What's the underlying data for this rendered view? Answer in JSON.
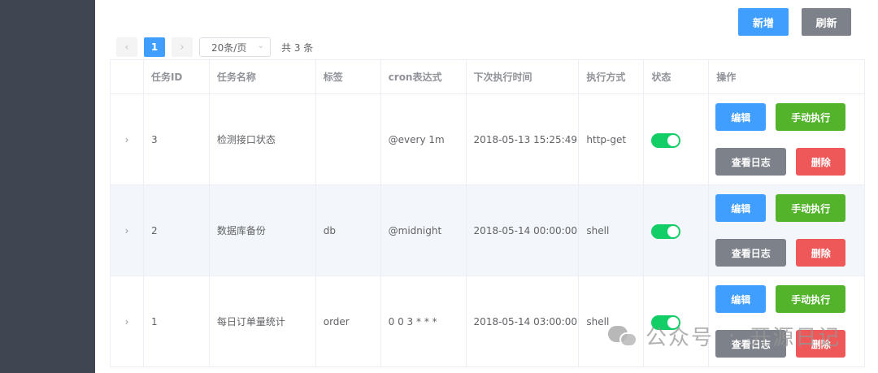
{
  "toolbar": {
    "add_label": "新增",
    "refresh_label": "刷新"
  },
  "pagination": {
    "prev": "‹",
    "current_page": "1",
    "next": "›",
    "page_size": "20条/页",
    "total_text": "共 3 条"
  },
  "table": {
    "headers": [
      "",
      "任务ID",
      "任务名称",
      "标签",
      "cron表达式",
      "下次执行时间",
      "执行方式",
      "状态",
      "操作"
    ],
    "rows": [
      {
        "expand": "›",
        "id": "3",
        "name": "检测接口状态",
        "tag": "",
        "cron": "@every 1m",
        "next_run": "2018-05-13 15:25:49",
        "protocol": "http-get",
        "enabled": true
      },
      {
        "expand": "›",
        "id": "2",
        "name": "数据库备份",
        "tag": "db",
        "cron": "@midnight",
        "next_run": "2018-05-14 00:00:00",
        "protocol": "shell",
        "enabled": true
      },
      {
        "expand": "›",
        "id": "1",
        "name": "每日订单量统计",
        "tag": "order",
        "cron": "0 0 3 * * *",
        "next_run": "2018-05-14 03:00:00",
        "protocol": "shell",
        "enabled": true
      }
    ],
    "actions": {
      "edit": "编辑",
      "run": "手动执行",
      "log": "查看日志",
      "delete": "删除"
    }
  },
  "watermark": {
    "left": "公众号",
    "right": "开源日记"
  },
  "colors": {
    "primary": "#409eff",
    "success": "#53b32b",
    "danger": "#ef5858",
    "info": "#7d8189",
    "switch_on": "#13ce66",
    "sidebar": "#3f4652"
  }
}
